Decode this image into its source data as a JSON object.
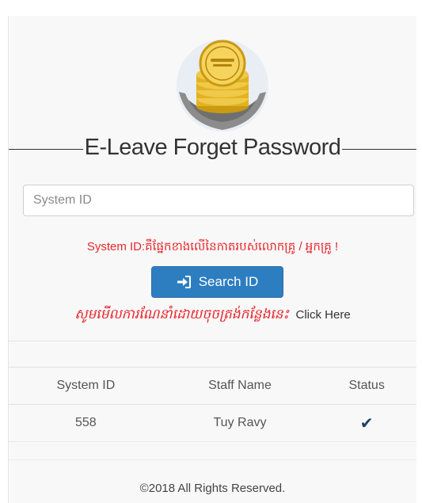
{
  "header": {
    "title": "E-Leave Forget Password"
  },
  "form": {
    "system_id_placeholder": "System ID",
    "warning": "System ID:គឺផ្នែកខាងលើនៃកាតរបស់លោកគ្រូ / អ្នកគ្រូ !",
    "search_button_label": "Search ID",
    "help_text": "សូមមើលការណែនាំដោយចុចត្រង់កន្លែងនេះ",
    "help_link": "Click Here"
  },
  "table": {
    "headers": [
      "System ID",
      "Staff Name",
      "Status"
    ],
    "rows": [
      {
        "system_id": "558",
        "staff_name": "Tuy Ravy",
        "status": "✔"
      }
    ]
  },
  "footer": {
    "copyright": "©2018 All Rights Reserved."
  },
  "colors": {
    "accent": "#2d7ec0",
    "warning": "#e8252b",
    "check": "#1f3f66"
  },
  "icons": {
    "search_button_icon": "sign-in-icon",
    "status_icon": "check-icon",
    "logo": "coin-stack-hands-logo"
  }
}
